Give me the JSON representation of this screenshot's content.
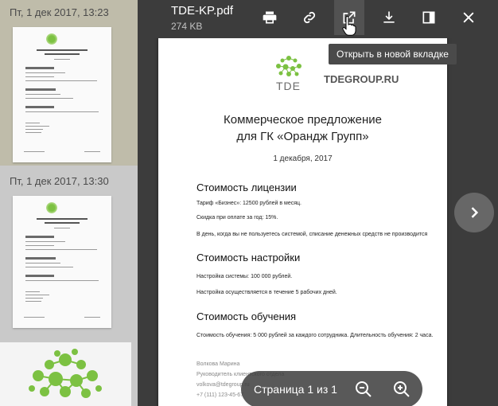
{
  "sidebar": {
    "messages": [
      {
        "timestamp": "Пт, 1 дек 2017, 13:23"
      },
      {
        "timestamp": "Пт, 1 дек 2017, 13:30"
      }
    ]
  },
  "viewer": {
    "file_name": "TDE-KP.pdf",
    "file_size": "274 KB",
    "toolbar": {
      "icons": [
        "print-icon",
        "link-icon",
        "open-external-icon",
        "download-icon",
        "panel-icon",
        "close-icon"
      ],
      "tooltip": "Открыть в новой вкладке"
    },
    "page_indicator": "Страница 1 из 1"
  },
  "document": {
    "logo_text": "TDE",
    "brand": "TDEGROUP.RU",
    "title_line1": "Коммерческое предложение",
    "title_line2": "для ГК «Орандж Групп»",
    "date": "1 декабря, 2017",
    "license_heading": "Стоимость лицензии",
    "license_lines": [
      "Тариф «Бизнес»: 12500 рублей в месяц.",
      "Скидка при оплате за год: 15%.",
      "В день, когда вы не пользуетесь системой, списание денежных средств не производится"
    ],
    "setup_heading": "Стоимость настройки",
    "setup_lines": [
      "Настройка системы: 100 000 рублей.",
      "Настройка осуществляется в течение 5 рабочих дней."
    ],
    "training_heading": "Стоимость обучения",
    "training_lines": [
      "Стоимость обучения: 5 000 рублей за каждого сотрудника. Длительность обучения: 2 часа."
    ],
    "signature_lines": [
      "Волкова Марина",
      "Руководитель клиентского отдела",
      "volkova@tdegroup.ru",
      "+7 (111) 123-45-67"
    ]
  },
  "colors": {
    "accent_green": "#7cc142",
    "toolbar_bg": "#3c3c3c"
  }
}
